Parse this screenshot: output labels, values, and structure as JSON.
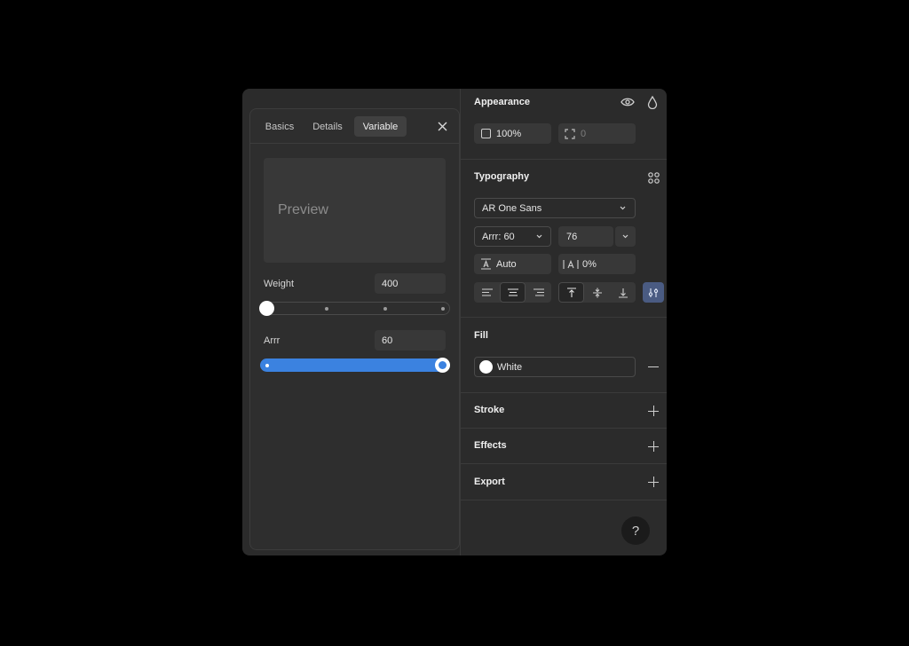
{
  "appearance": {
    "title": "Appearance",
    "opacity": "100%",
    "corner_radius": "0"
  },
  "typography": {
    "title": "Typography",
    "font_family": "AR One Sans",
    "style": "Arrr: 60",
    "size": "76",
    "line_height": "Auto",
    "letter_spacing": "0%"
  },
  "fill": {
    "title": "Fill",
    "color_name": "White",
    "color": "#ffffff"
  },
  "sections": {
    "stroke": "Stroke",
    "effects": "Effects",
    "export": "Export"
  },
  "help": {
    "label": "?"
  },
  "popover": {
    "tabs": [
      "Basics",
      "Details",
      "Variable"
    ],
    "active_tab": "Variable",
    "preview_text": "Preview",
    "axes": [
      {
        "label": "Weight",
        "value": "400",
        "slider_fraction": 0.0
      },
      {
        "label": "Arrr",
        "value": "60",
        "slider_fraction": 1.0
      }
    ]
  },
  "colors": {
    "accent": "#3b82e0",
    "panel": "#2b2b2b",
    "active_toggle": "#4a5b82"
  }
}
